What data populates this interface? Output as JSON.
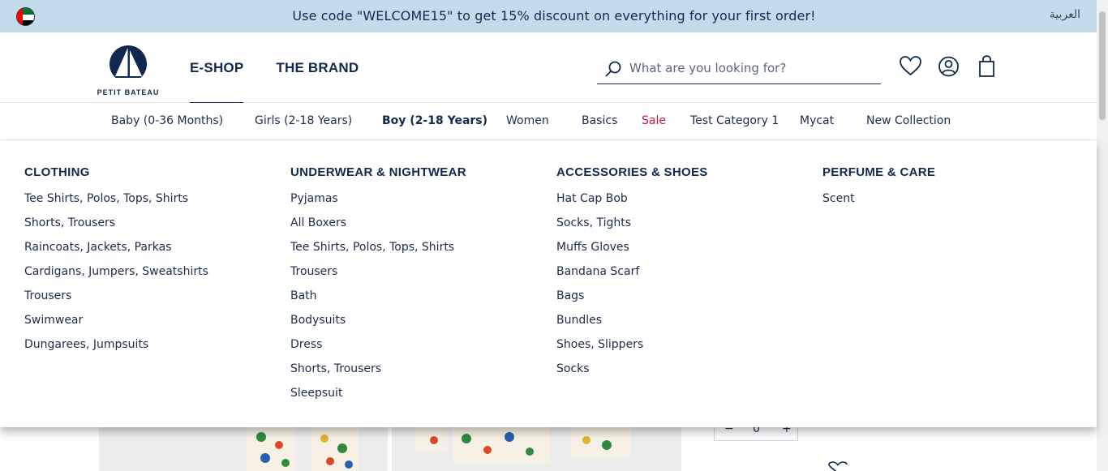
{
  "promo": {
    "message": "Use code \"WELCOME15\" to get 15% discount on everything for your first order!",
    "language_switch": "العربية",
    "flag_icon": "uae-flag-icon"
  },
  "brand": {
    "logo_text": "PETIT BATEAU"
  },
  "top_nav": [
    {
      "label": "E-SHOP",
      "active": true
    },
    {
      "label": "THE BRAND",
      "active": false
    }
  ],
  "search": {
    "placeholder": "What are you looking for?",
    "value": ""
  },
  "header_icons": [
    "heart-icon",
    "account-icon",
    "shopping-bag-icon"
  ],
  "categories": [
    {
      "label": "Baby (0-36 Months)"
    },
    {
      "label": "Girls (2-18 Years)"
    },
    {
      "label": "Boy (2-18 Years)",
      "active": true
    },
    {
      "label": "Women"
    },
    {
      "label": "Basics"
    },
    {
      "label": "Sale",
      "color": "#d0133d"
    },
    {
      "label": "Test Category 1"
    },
    {
      "label": "Mycat"
    },
    {
      "label": "New Collection"
    }
  ],
  "mega_menu": [
    {
      "heading": "CLOTHING",
      "items": [
        "Tee Shirts, Polos, Tops, Shirts",
        "Shorts, Trousers",
        "Raincoats, Jackets, Parkas",
        "Cardigans, Jumpers, Sweatshirts",
        "Trousers",
        "Swimwear",
        "Dungarees, Jumpsuits"
      ]
    },
    {
      "heading": "UNDERWEAR & NIGHTWEAR",
      "items": [
        "Pyjamas",
        "All Boxers",
        "Tee Shirts, Polos, Tops, Shirts",
        "Trousers",
        "Bath",
        "Bodysuits",
        "Dress",
        "Shorts, Trousers",
        "Sleepsuit"
      ]
    },
    {
      "heading": "ACCESSORIES & SHOES",
      "items": [
        "Hat Cap Bob",
        "Socks, Tights",
        "Muffs Gloves",
        "Bandana Scarf",
        "Bags",
        "Bundles",
        "Shoes, Slippers",
        "Socks"
      ]
    },
    {
      "heading": "PERFUME & CARE",
      "items": [
        "Scent"
      ]
    }
  ],
  "product": {
    "quantity": {
      "minus": "−",
      "value": "0",
      "plus": "+"
    }
  },
  "colors": {
    "banner_bg": "#c4dbeb",
    "brand_navy": "#12294f",
    "sale_red": "#d0133d"
  }
}
